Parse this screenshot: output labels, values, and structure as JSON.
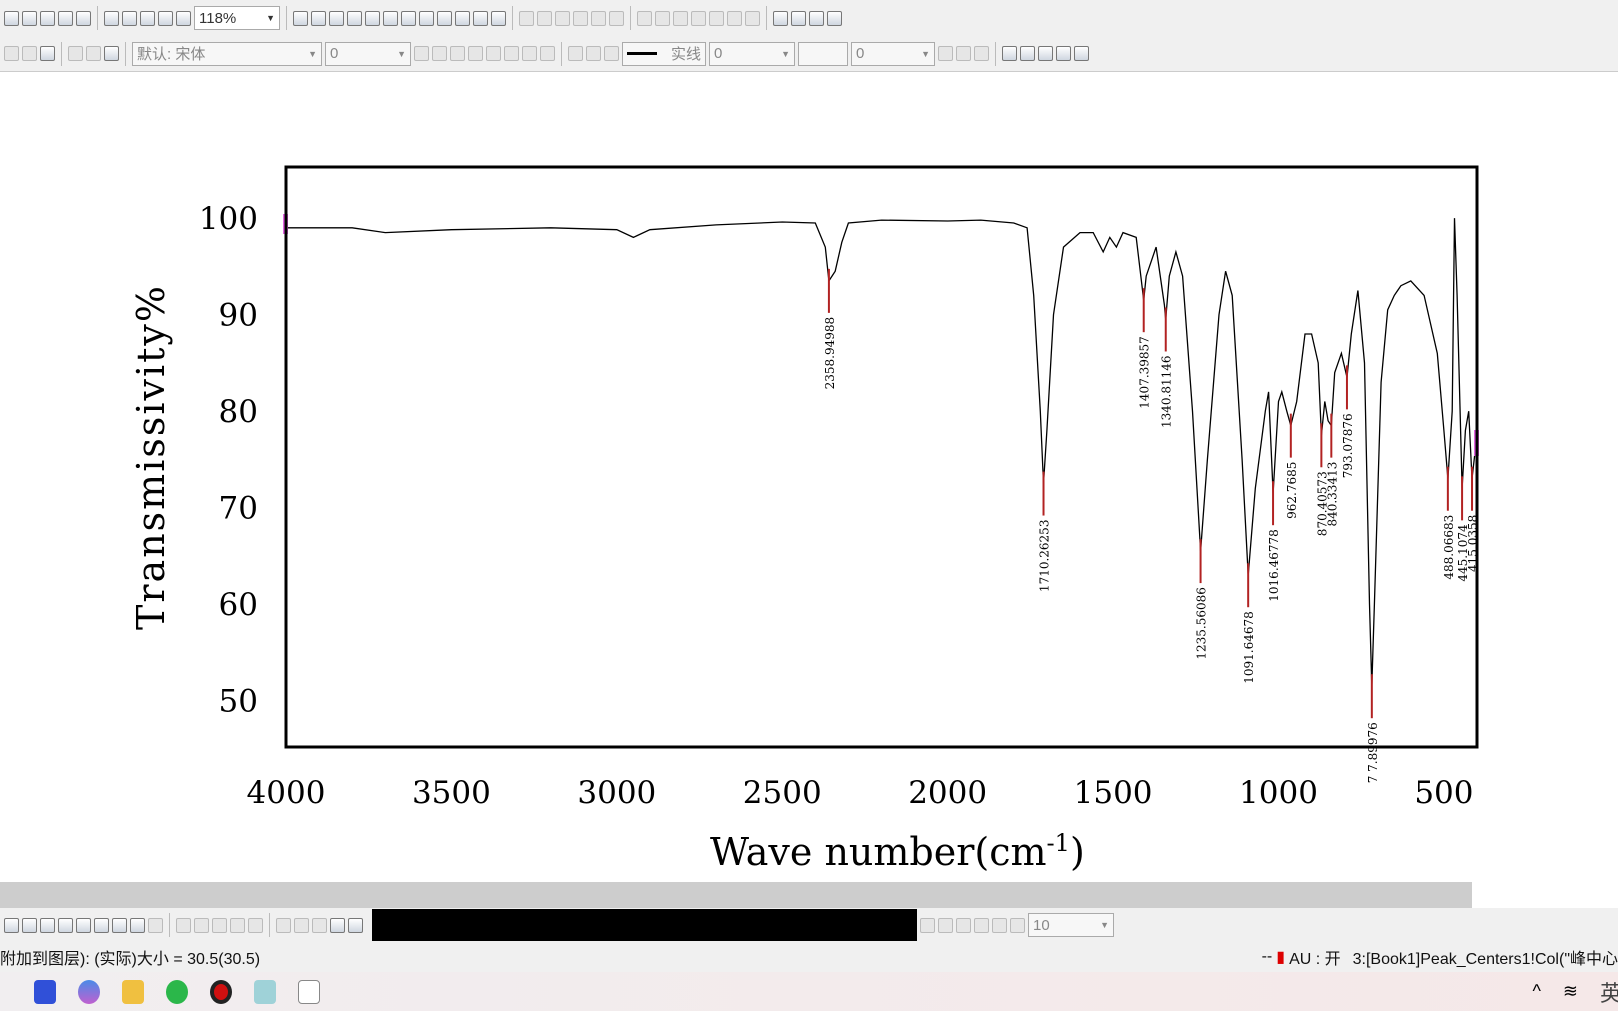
{
  "toolbar": {
    "zoom": "118%",
    "font": "默认: 宋体",
    "font_size": "0",
    "line_style": "实线",
    "line_width": "0",
    "fill_value": "0",
    "pattern_size": "10"
  },
  "status": {
    "left": "附加到图层): (实际)大小 = 30.5(30.5)",
    "dash": "--",
    "au": "AU : 开",
    "right": "3:[Book1]Peak_Centers1!Col(\"峰中心"
  },
  "taskbar": {
    "tray_text": "英",
    "icons": [
      "origin-icon",
      "copilot-icon",
      "file-explorer-icon",
      "wechat-icon",
      "record-icon",
      "notepad-icon",
      "blank-document-icon"
    ]
  },
  "colors": {
    "curve": "#000000",
    "peak_marker": "#b22222",
    "frame": "#000000"
  },
  "chart_data": {
    "type": "line",
    "xlabel": "Wave number(cm",
    "xlabel_sup": "-1",
    "xlabel_end": ")",
    "ylabel": "Transmissivity%",
    "xlim": [
      4000,
      400
    ],
    "ylim": [
      45.2,
      105.3
    ],
    "xticks": [
      4000,
      3500,
      3000,
      2500,
      2000,
      1500,
      1000,
      500
    ],
    "yticks": [
      50,
      60,
      70,
      80,
      90,
      100
    ],
    "grid": false,
    "series": [
      {
        "x": [
          4000,
          3800,
          3700,
          3500,
          3200,
          3000,
          2950,
          2900,
          2700,
          2500,
          2400,
          2370,
          2358.95,
          2340,
          2320,
          2300,
          2200,
          2000,
          1900,
          1800,
          1760,
          1740,
          1720,
          1710.26,
          1700,
          1680,
          1650,
          1600,
          1560,
          1530,
          1510,
          1490,
          1470,
          1430,
          1407.4,
          1400,
          1370,
          1345,
          1340.81,
          1330,
          1310,
          1290,
          1260,
          1235.56,
          1215,
          1180,
          1160,
          1140,
          1110,
          1091.65,
          1070,
          1040,
          1030,
          1016.47,
          1000,
          990,
          975,
          962.77,
          945,
          920,
          900,
          880,
          870.41,
          860,
          850,
          840.33,
          830,
          810,
          793.08,
          780,
          760,
          740,
          725,
          717.9,
          710,
          690,
          670,
          650,
          630,
          600,
          560,
          520,
          500,
          488.07,
          475,
          468,
          460,
          445.11,
          435,
          425,
          415.04,
          405,
          400
        ],
        "y": [
          99,
          99,
          98.5,
          98.8,
          99,
          98.8,
          98,
          98.8,
          99.3,
          99.6,
          99.5,
          97,
          93.5,
          94.5,
          97.5,
          99.5,
          99.8,
          99.7,
          99.8,
          99.5,
          99,
          92,
          80,
          72.5,
          78,
          90,
          97,
          98.5,
          98.5,
          96.5,
          98,
          97,
          98.5,
          98,
          91.5,
          94,
          97,
          91,
          89.5,
          94,
          96.5,
          94,
          80,
          65.5,
          75,
          90,
          94.5,
          92,
          75,
          63,
          72,
          80,
          82,
          71.5,
          81,
          82,
          80,
          78.5,
          81,
          88,
          88,
          85,
          77.5,
          81,
          79,
          78.5,
          84,
          86,
          83.5,
          88,
          92.5,
          85,
          60,
          51.5,
          60,
          83,
          90.5,
          92,
          93,
          93.5,
          92,
          86,
          78,
          73,
          80,
          100,
          92,
          72,
          78,
          80,
          73,
          76,
          76
        ]
      }
    ],
    "peak_labels": [
      {
        "x": 2358.94988,
        "y": 93.5,
        "label": "2358.94988"
      },
      {
        "x": 1710.26253,
        "y": 72.5,
        "label": "1710.26253"
      },
      {
        "x": 1407.39857,
        "y": 91.5,
        "label": "1407.39857"
      },
      {
        "x": 1340.81146,
        "y": 89.5,
        "label": "1340.81146"
      },
      {
        "x": 1235.56086,
        "y": 65.5,
        "label": "1235.56086"
      },
      {
        "x": 1091.64678,
        "y": 63,
        "label": "1091.64678"
      },
      {
        "x": 1016.46778,
        "y": 71.5,
        "label": "1016.46778"
      },
      {
        "x": 962.7685,
        "y": 78.5,
        "label": "962.7685"
      },
      {
        "x": 870.40573,
        "y": 77.5,
        "label": "870.40573"
      },
      {
        "x": 840.33413,
        "y": 78.5,
        "label": "840.33413"
      },
      {
        "x": 793.07876,
        "y": 83.5,
        "label": "793.07876"
      },
      {
        "x": 717.89976,
        "y": 51.5,
        "label": "7 7.89976"
      },
      {
        "x": 488.06683,
        "y": 73,
        "label": "488.06683"
      },
      {
        "x": 445.1074,
        "y": 72,
        "label": "445.1074"
      },
      {
        "x": 415.0358,
        "y": 73,
        "label": "415.0358"
      }
    ]
  }
}
